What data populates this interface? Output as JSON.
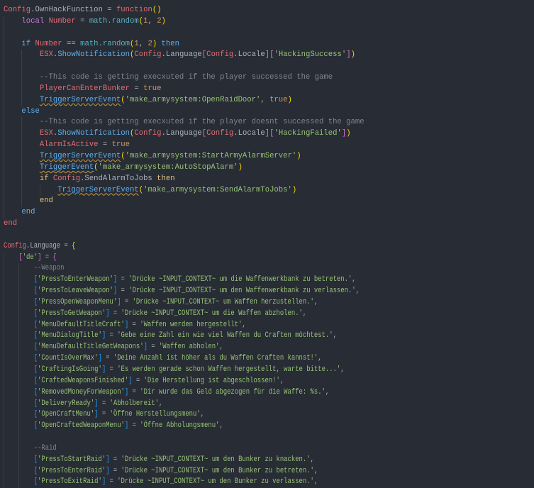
{
  "theme": {
    "background": "#282c34",
    "variable": "#e06c75",
    "function": "#61afef",
    "string": "#98c379",
    "number": "#d19a66",
    "comment": "#7f848e",
    "keyword": "#c678dd"
  },
  "code": {
    "section1": [
      {
        "i": 0,
        "t": [
          [
            "v",
            "Config"
          ],
          [
            "o",
            ".OwnHackFunction = "
          ],
          [
            "kr",
            "function"
          ],
          [
            "b1",
            "()"
          ]
        ]
      },
      {
        "i": 1,
        "t": [
          [
            "k",
            "local"
          ],
          [
            "o",
            " "
          ],
          [
            "v",
            "Number"
          ],
          [
            "o",
            " = "
          ],
          [
            "m",
            "math.random"
          ],
          [
            "b1",
            "("
          ],
          [
            "n",
            "1"
          ],
          [
            "o",
            ", "
          ],
          [
            "n",
            "2"
          ],
          [
            "b1",
            ")"
          ]
        ]
      },
      {
        "i": 1,
        "t": []
      },
      {
        "i": 1,
        "t": [
          [
            "kb",
            "if"
          ],
          [
            "o",
            " "
          ],
          [
            "v",
            "Number"
          ],
          [
            "o",
            " == "
          ],
          [
            "m",
            "math.random"
          ],
          [
            "b1",
            "("
          ],
          [
            "n",
            "1"
          ],
          [
            "o",
            ", "
          ],
          [
            "n",
            "2"
          ],
          [
            "b1",
            ")"
          ],
          [
            "o",
            " "
          ],
          [
            "kb",
            "then"
          ]
        ]
      },
      {
        "i": 2,
        "t": [
          [
            "v",
            "ESX"
          ],
          [
            "o",
            "."
          ],
          [
            "f",
            "ShowNotification"
          ],
          [
            "b1",
            "("
          ],
          [
            "v",
            "Config"
          ],
          [
            "o",
            ".Language"
          ],
          [
            "b2",
            "["
          ],
          [
            "v",
            "Config"
          ],
          [
            "o",
            ".Locale"
          ],
          [
            "b2",
            "]["
          ],
          [
            "s",
            "'HackingSuccess'"
          ],
          [
            "b2",
            "]"
          ],
          [
            "b1",
            ")"
          ]
        ]
      },
      {
        "i": 2,
        "t": []
      },
      {
        "i": 2,
        "t": [
          [
            "c",
            "--This code is getting execxuted if the player successed the game"
          ]
        ]
      },
      {
        "i": 2,
        "t": [
          [
            "v",
            "PlayerCanEnterBunker"
          ],
          [
            "o",
            " = "
          ],
          [
            "n",
            "true"
          ]
        ]
      },
      {
        "i": 2,
        "t": [
          [
            "fw",
            "TriggerServerEvent"
          ],
          [
            "b1",
            "("
          ],
          [
            "s",
            "'make_armysystem:OpenRaidDoor'"
          ],
          [
            "o",
            ", "
          ],
          [
            "n",
            "true"
          ],
          [
            "b1",
            ")"
          ]
        ]
      },
      {
        "i": 1,
        "t": [
          [
            "kb",
            "else"
          ]
        ]
      },
      {
        "i": 2,
        "t": [
          [
            "c",
            "--This code is getting execxuted if the player doesnt successed the game"
          ]
        ]
      },
      {
        "i": 2,
        "t": [
          [
            "v",
            "ESX"
          ],
          [
            "o",
            "."
          ],
          [
            "f",
            "ShowNotification"
          ],
          [
            "b1",
            "("
          ],
          [
            "v",
            "Config"
          ],
          [
            "o",
            ".Language"
          ],
          [
            "b2",
            "["
          ],
          [
            "v",
            "Config"
          ],
          [
            "o",
            ".Locale"
          ],
          [
            "b2",
            "]["
          ],
          [
            "s",
            "'HackingFailed'"
          ],
          [
            "b2",
            "]"
          ],
          [
            "b1",
            ")"
          ]
        ]
      },
      {
        "i": 2,
        "t": [
          [
            "v",
            "AlarmIsActive"
          ],
          [
            "o",
            " = "
          ],
          [
            "n",
            "true"
          ]
        ]
      },
      {
        "i": 2,
        "t": [
          [
            "fw",
            "TriggerServerEvent"
          ],
          [
            "b1",
            "("
          ],
          [
            "s",
            "'make_armysystem:StartArmyAlarmServer'"
          ],
          [
            "b1",
            ")"
          ]
        ]
      },
      {
        "i": 2,
        "t": [
          [
            "fw",
            "TriggerEvent"
          ],
          [
            "b1",
            "("
          ],
          [
            "s",
            "'make_armysystem:AutoStopAlarm'"
          ],
          [
            "b1",
            ")"
          ]
        ]
      },
      {
        "i": 2,
        "t": [
          [
            "ky",
            "if"
          ],
          [
            "o",
            " "
          ],
          [
            "v",
            "Config"
          ],
          [
            "o",
            ".SendAlarmToJobs "
          ],
          [
            "ky",
            "then"
          ]
        ]
      },
      {
        "i": 3,
        "t": [
          [
            "fw",
            "TriggerServerEvent"
          ],
          [
            "b1",
            "("
          ],
          [
            "s",
            "'make_armysystem:SendAlarmToJobs'"
          ],
          [
            "b1",
            ")"
          ]
        ]
      },
      {
        "i": 2,
        "t": [
          [
            "ky",
            "end"
          ]
        ]
      },
      {
        "i": 1,
        "t": [
          [
            "kb",
            "end"
          ]
        ]
      },
      {
        "i": 0,
        "t": [
          [
            "kr",
            "end"
          ]
        ]
      },
      {
        "i": 0,
        "t": []
      }
    ],
    "section2": [
      {
        "i": 0,
        "t": [
          [
            "v",
            "Config"
          ],
          [
            "o",
            ".Language = "
          ],
          [
            "b1",
            "{"
          ]
        ]
      },
      {
        "i": 1,
        "t": [
          [
            "b2",
            "["
          ],
          [
            "s",
            "'de'"
          ],
          [
            "b2",
            "]"
          ],
          [
            "o",
            " = "
          ],
          [
            "b2",
            "{"
          ]
        ]
      },
      {
        "i": 2,
        "t": [
          [
            "c",
            "--Weapon"
          ]
        ]
      },
      {
        "i": 2,
        "t": [
          [
            "b3",
            "["
          ],
          [
            "s",
            "'PressToEnterWeapon'"
          ],
          [
            "b3",
            "]"
          ],
          [
            "o",
            " = "
          ],
          [
            "s",
            "'Drücke ~INPUT_CONTEXT~ um die Waffenwerkbank zu betreten.'"
          ],
          [
            "o",
            ","
          ]
        ]
      },
      {
        "i": 2,
        "t": [
          [
            "b3",
            "["
          ],
          [
            "s",
            "'PressToLeaveWeapon'"
          ],
          [
            "b3",
            "]"
          ],
          [
            "o",
            " = "
          ],
          [
            "s",
            "'Drücke ~INPUT_CONTEXT~ um den Waffenwerkbank zu verlassen.'"
          ],
          [
            "o",
            ","
          ]
        ]
      },
      {
        "i": 2,
        "t": [
          [
            "b3",
            "["
          ],
          [
            "s",
            "'PressOpenWeaponMenu'"
          ],
          [
            "b3",
            "]"
          ],
          [
            "o",
            " = "
          ],
          [
            "s",
            "'Drücke ~INPUT_CONTEXT~ um Waffen herzustellen.'"
          ],
          [
            "o",
            ","
          ]
        ]
      },
      {
        "i": 2,
        "t": [
          [
            "b3",
            "["
          ],
          [
            "s",
            "'PressToGetWeapon'"
          ],
          [
            "b3",
            "]"
          ],
          [
            "o",
            " = "
          ],
          [
            "s",
            "'Drücke ~INPUT_CONTEXT~ um die Waffen abzholen.'"
          ],
          [
            "o",
            ","
          ]
        ]
      },
      {
        "i": 2,
        "t": [
          [
            "b3",
            "["
          ],
          [
            "s",
            "'MenuDefaultTitleCraft'"
          ],
          [
            "b3",
            "]"
          ],
          [
            "o",
            " = "
          ],
          [
            "s",
            "'Waffen werden hergestellt'"
          ],
          [
            "o",
            ","
          ]
        ]
      },
      {
        "i": 2,
        "t": [
          [
            "b3",
            "["
          ],
          [
            "s",
            "'MenuDialogTitle'"
          ],
          [
            "b3",
            "]"
          ],
          [
            "o",
            " = "
          ],
          [
            "s",
            "'Gebe eine Zahl ein wie viel Waffen du Craften möchtest.'"
          ],
          [
            "o",
            ","
          ]
        ]
      },
      {
        "i": 2,
        "t": [
          [
            "b3",
            "["
          ],
          [
            "s",
            "'MenuDefaultTitleGetWeapons'"
          ],
          [
            "b3",
            "]"
          ],
          [
            "o",
            " = "
          ],
          [
            "s",
            "'Waffen abholen'"
          ],
          [
            "o",
            ","
          ]
        ]
      },
      {
        "i": 2,
        "t": [
          [
            "b3",
            "["
          ],
          [
            "s",
            "'CountIsOverMax'"
          ],
          [
            "b3",
            "]"
          ],
          [
            "o",
            " = "
          ],
          [
            "s",
            "'Deine Anzahl ist höher als du Waffen Craften kannst!'"
          ],
          [
            "o",
            ","
          ]
        ]
      },
      {
        "i": 2,
        "t": [
          [
            "b3",
            "["
          ],
          [
            "s",
            "'CraftingIsGoing'"
          ],
          [
            "b3",
            "]"
          ],
          [
            "o",
            " = "
          ],
          [
            "s",
            "'Es werden gerade schon Waffen hergestellt, warte bitte...'"
          ],
          [
            "o",
            ","
          ]
        ]
      },
      {
        "i": 2,
        "t": [
          [
            "b3",
            "["
          ],
          [
            "s",
            "'CraftedWeaponsFinished'"
          ],
          [
            "b3",
            "]"
          ],
          [
            "o",
            " = "
          ],
          [
            "s",
            "'Die Herstellung ist abgeschlossen!'"
          ],
          [
            "o",
            ","
          ]
        ]
      },
      {
        "i": 2,
        "t": [
          [
            "b3",
            "["
          ],
          [
            "s",
            "'RemovedMoneyForWeapon'"
          ],
          [
            "b3",
            "]"
          ],
          [
            "o",
            " = "
          ],
          [
            "s",
            "'Dir wurde das Geld abgezogen für die Waffe: %s.'"
          ],
          [
            "o",
            ","
          ]
        ]
      },
      {
        "i": 2,
        "t": [
          [
            "b3",
            "["
          ],
          [
            "s",
            "'DeliveryReady'"
          ],
          [
            "b3",
            "]"
          ],
          [
            "o",
            " = "
          ],
          [
            "s",
            "'Abholbereit'"
          ],
          [
            "o",
            ","
          ]
        ]
      },
      {
        "i": 2,
        "t": [
          [
            "b3",
            "["
          ],
          [
            "s",
            "'OpenCraftMenu'"
          ],
          [
            "b3",
            "]"
          ],
          [
            "o",
            " = "
          ],
          [
            "s",
            "'Öffne Herstellungsmenu'"
          ],
          [
            "o",
            ","
          ]
        ]
      },
      {
        "i": 2,
        "t": [
          [
            "b3",
            "["
          ],
          [
            "s",
            "'OpenCraftedWeaponMenu'"
          ],
          [
            "b3",
            "]"
          ],
          [
            "o",
            " = "
          ],
          [
            "s",
            "'Öffne Abholungsmenu'"
          ],
          [
            "o",
            ","
          ]
        ]
      },
      {
        "i": 2,
        "t": []
      },
      {
        "i": 2,
        "t": [
          [
            "c",
            "--Raid"
          ]
        ]
      },
      {
        "i": 2,
        "t": [
          [
            "b3",
            "["
          ],
          [
            "s",
            "'PressToStartRaid'"
          ],
          [
            "b3",
            "]"
          ],
          [
            "o",
            " = "
          ],
          [
            "s",
            "'Drücke ~INPUT_CONTEXT~ um den Bunker zu knacken.'"
          ],
          [
            "o",
            ","
          ]
        ]
      },
      {
        "i": 2,
        "t": [
          [
            "b3",
            "["
          ],
          [
            "s",
            "'PressToEnterRaid'"
          ],
          [
            "b3",
            "]"
          ],
          [
            "o",
            " = "
          ],
          [
            "s",
            "'Drücke ~INPUT_CONTEXT~ um den Bunker zu betreten.'"
          ],
          [
            "o",
            ","
          ]
        ]
      },
      {
        "i": 2,
        "t": [
          [
            "b3",
            "["
          ],
          [
            "s",
            "'PressToExitRaid'"
          ],
          [
            "b3",
            "]"
          ],
          [
            "o",
            " = "
          ],
          [
            "s",
            "'Drücke ~INPUT_CONTEXT~ um den Bunker zu verlassen.'"
          ],
          [
            "o",
            ","
          ]
        ]
      }
    ]
  }
}
